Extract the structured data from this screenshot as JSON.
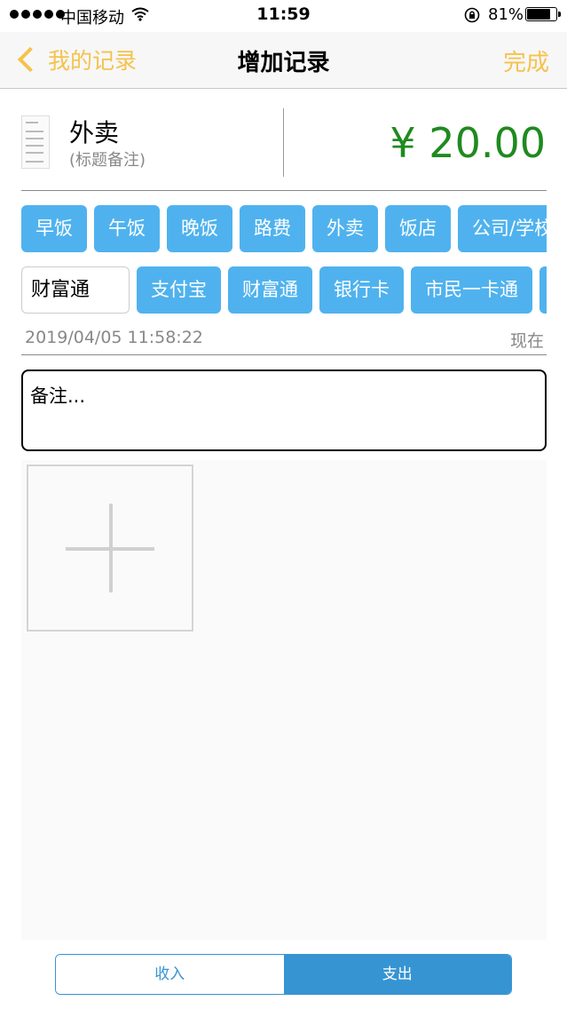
{
  "status_bar": {
    "carrier": "中国移动",
    "time": "11:59",
    "battery": "81%",
    "battery_level": 0.81
  },
  "nav": {
    "back_label": "我的记录",
    "title": "增加记录",
    "done_label": "完成"
  },
  "record": {
    "title": "外卖",
    "note_hint": "(标题备注)",
    "amount": "¥ 20.00"
  },
  "categories": [
    "早饭",
    "午饭",
    "晚饭",
    "路费",
    "外卖",
    "饭店",
    "公司/学校"
  ],
  "account": {
    "selected": "财富通",
    "options": [
      "支付宝",
      "财富通",
      "银行卡",
      "市民一卡通",
      ""
    ]
  },
  "datetime": {
    "value": "2019/04/05 11:58:22",
    "now_label": "现在"
  },
  "remark": {
    "placeholder": "备注..."
  },
  "type_switch": {
    "income_label": "收入",
    "expense_label": "支出",
    "selected": "支出"
  },
  "colors": {
    "accent": "#f5c24c",
    "chip": "#4fb2ee",
    "amount": "#1f8a1f",
    "segment": "#3794d2"
  }
}
